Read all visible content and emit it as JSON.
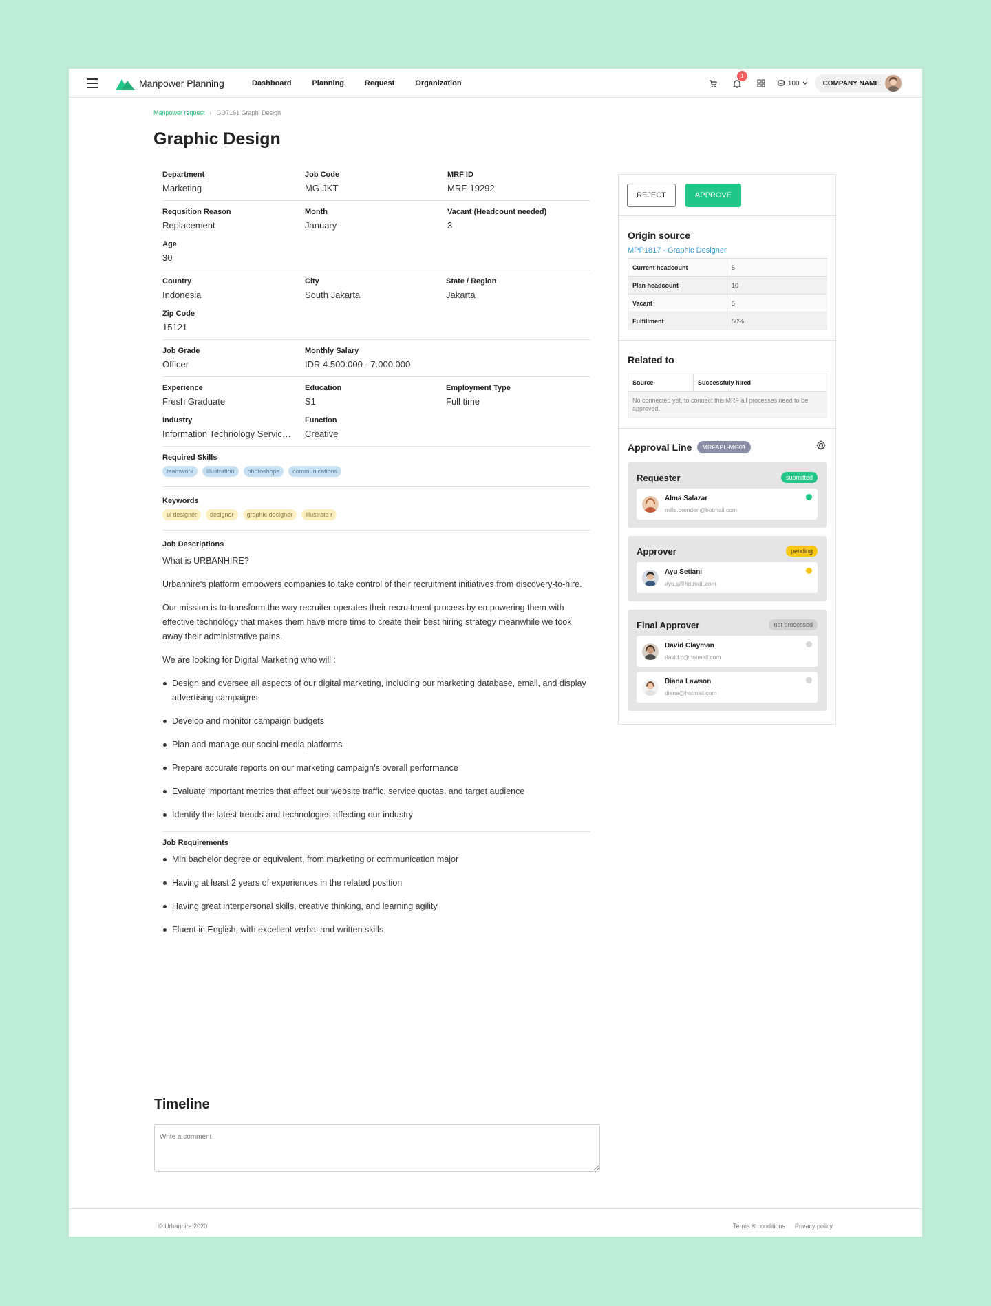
{
  "header": {
    "app_name": "Manpower Planning",
    "nav": [
      "Dashboard",
      "Planning",
      "Request",
      "Organization"
    ],
    "notification_count": "1",
    "credits": "100",
    "company": "COMPANY NAME"
  },
  "breadcrumb": {
    "parent": "Manpower request",
    "current": "GD7161 Graphi Design"
  },
  "page_title": "Graphic Design",
  "fields": {
    "department": {
      "label": "Department",
      "value": "Marketing"
    },
    "job_code": {
      "label": "Job Code",
      "value": "MG-JKT"
    },
    "mrf_id": {
      "label": "MRF ID",
      "value": "MRF-19292"
    },
    "reason": {
      "label": "Requsition Reason",
      "value": "Replacement"
    },
    "month": {
      "label": "Month",
      "value": "January"
    },
    "vacant": {
      "label": "Vacant (Headcount needed)",
      "value": "3"
    },
    "age": {
      "label": "Age",
      "value": "30"
    },
    "country": {
      "label": "Country",
      "value": "Indonesia"
    },
    "city": {
      "label": "City",
      "value": "South Jakarta"
    },
    "state": {
      "label": "State / Region",
      "value": "Jakarta"
    },
    "zip": {
      "label": "Zip Code",
      "value": "15121"
    },
    "grade": {
      "label": "Job Grade",
      "value": "Officer"
    },
    "salary": {
      "label": "Monthly Salary",
      "value": "IDR 4.500.000 - 7.000.000"
    },
    "experience": {
      "label": "Experience",
      "value": "Fresh Graduate"
    },
    "education": {
      "label": "Education",
      "value": "S1"
    },
    "employment": {
      "label": "Employment Type",
      "value": "Full time"
    },
    "industry": {
      "label": "Industry",
      "value": "Information Technology Servic…"
    },
    "function": {
      "label": "Function",
      "value": "Creative"
    }
  },
  "skills": {
    "label": "Required Skills",
    "items": [
      "teamwork",
      "illustration",
      "photoshops",
      "communications"
    ]
  },
  "keywords": {
    "label": "Keywords",
    "items": [
      "ui designer",
      "designer",
      "graphic designer",
      "illustrato r"
    ]
  },
  "job_descriptions": {
    "label": "Job Descriptions",
    "paragraphs": [
      "What is URBANHIRE?",
      "Urbanhire's platform empowers companies to take control of their recruitment initiatives from discovery-to-hire.",
      "Our mission is to transform the way recruiter operates their recruitment process by empowering them with effective technology that makes them have more time to create their best hiring strategy meanwhile we took away their administrative pains.",
      "We are looking for Digital Marketing who will :"
    ],
    "bullets": [
      "Design and oversee all aspects of our digital marketing, including our marketing database, email, and display advertising campaigns",
      "Develop and monitor campaign budgets",
      "Plan and manage our social media platforms",
      "Prepare accurate reports on our marketing campaign's overall performance",
      "Evaluate important metrics that affect our website traffic, service quotas, and target audience",
      "Identify the latest trends and technologies affecting our industry"
    ]
  },
  "job_requirements": {
    "label": "Job Requirements",
    "bullets": [
      "Min bachelor degree or equivalent, from marketing or communication major",
      "Having at least 2 years of experiences in the related position",
      "Having great interpersonal skills, creative thinking, and learning agility",
      "Fluent in English, with excellent verbal and written skills"
    ]
  },
  "timeline": {
    "title": "Timeline",
    "placeholder": "Write a comment"
  },
  "footer": {
    "copyright": "© Urbanhire 2020",
    "terms": "Terms & conditions",
    "privacy": "Privacy policy"
  },
  "side": {
    "reject_label": "REJECT",
    "approve_label": "APPROVE",
    "origin": {
      "title": "Origin source",
      "link": "MPP1817 - Graphic Designer",
      "rows": [
        {
          "label": "Current headcount",
          "value": "5"
        },
        {
          "label": "Plan headcount",
          "value": "10"
        },
        {
          "label": "Vacant",
          "value": "5"
        },
        {
          "label": "Fulfillment",
          "value": "50%"
        }
      ]
    },
    "related": {
      "title": "Related to",
      "col_source": "Source",
      "col_hired": "Successfuly hired",
      "empty": "No connected yet, to connect this MRF all processes need to be approved."
    },
    "approval": {
      "title": "Approval Line",
      "code": "MRFAPL-MG01",
      "groups": [
        {
          "title": "Requester",
          "status": "submitted",
          "people": [
            {
              "name": "Alma Salazar",
              "email": "mills.brenden@hotmail.com"
            }
          ]
        },
        {
          "title": "Approver",
          "status": "pending",
          "people": [
            {
              "name": "Ayu Setiani",
              "email": "ayu.s@hotmail.com"
            }
          ]
        },
        {
          "title": "Final Approver",
          "status": "not processed",
          "people": [
            {
              "name": "David Clayman",
              "email": "david.c@hotmail.com"
            },
            {
              "name": "Diana Lawson",
              "email": "diana@hotmail.com"
            }
          ]
        }
      ]
    }
  }
}
